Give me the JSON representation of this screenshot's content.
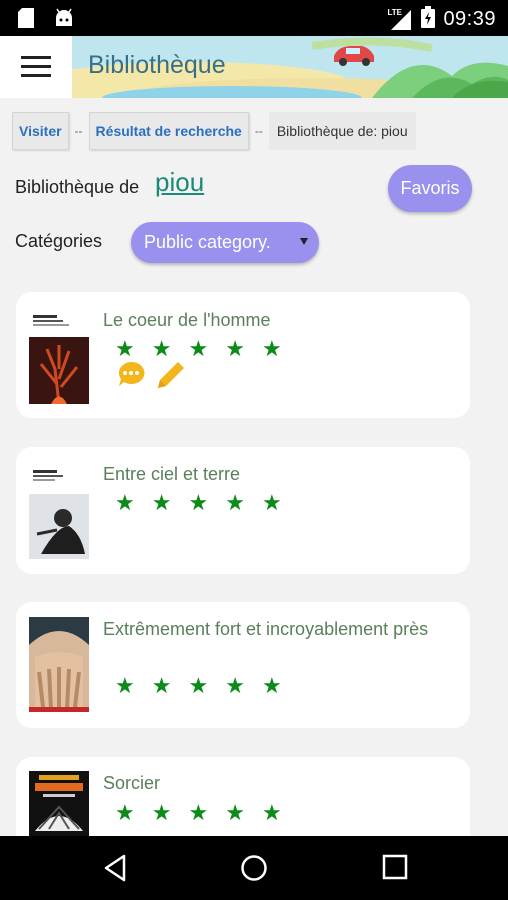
{
  "status_bar": {
    "time": "09:39",
    "network": "LTE",
    "icons": [
      "sd-card-icon",
      "android-icon",
      "signal-icon",
      "battery-icon"
    ]
  },
  "app_bar": {
    "title": "Bibliothèque",
    "menu_icon": "hamburger-menu-icon"
  },
  "breadcrumbs": {
    "items": [
      {
        "label": "Visiter"
      },
      {
        "label": "Résultat de recherche"
      }
    ],
    "separator": "--",
    "current": "Bibliothèque de: piou"
  },
  "library": {
    "label": "Bibliothèque de",
    "user": "piou",
    "favorites_label": "Favoris"
  },
  "categories": {
    "label": "Catégories",
    "selected": "Public category."
  },
  "books": [
    {
      "title": "Le coeur de l'homme",
      "rating": 5,
      "has_actions": true
    },
    {
      "title": "Entre ciel et terre",
      "rating": 5,
      "has_actions": false
    },
    {
      "title": "Extrêmement fort et incroyablement près",
      "rating": 5,
      "has_actions": false
    },
    {
      "title": "Sorcier",
      "rating": 5,
      "has_actions": false
    }
  ],
  "colors": {
    "accent": "#9a90ee",
    "star": "#0c8a1a",
    "link": "#2b6fc1",
    "title_green": "#5a7f5a"
  },
  "nav_bar": {
    "icons": [
      "back-icon",
      "home-icon",
      "recents-icon"
    ]
  }
}
